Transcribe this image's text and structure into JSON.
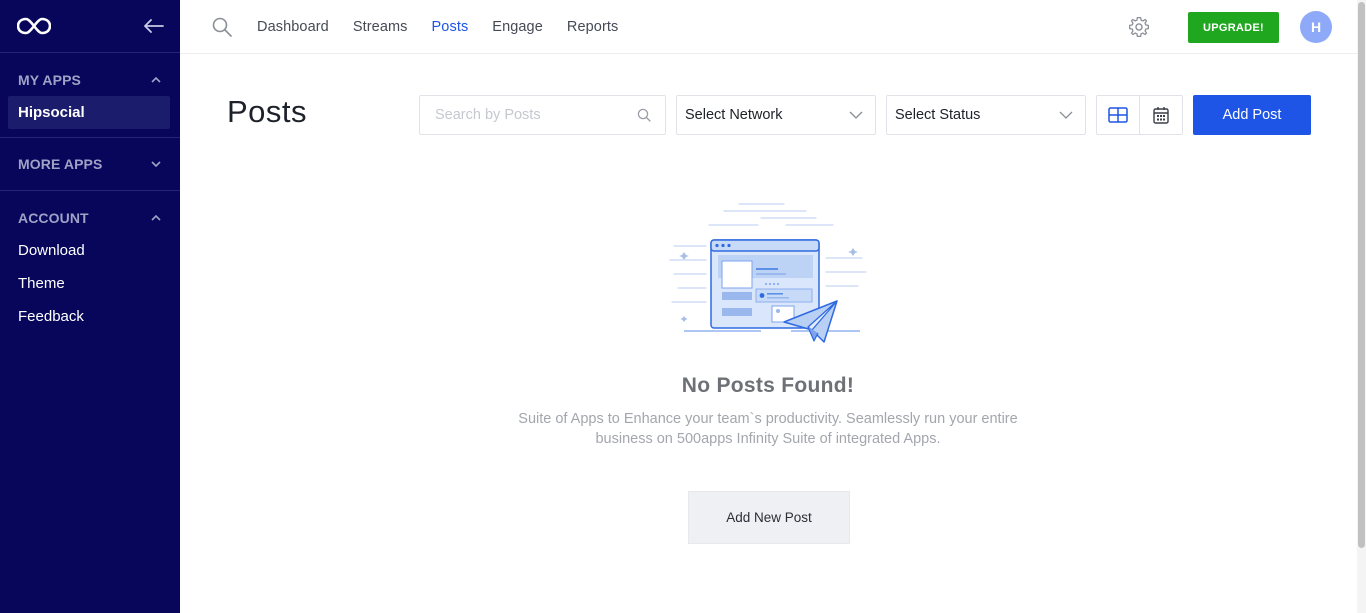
{
  "sidebar": {
    "my_apps_label": "MY APPS",
    "my_apps_items": [
      {
        "label": "Hipsocial"
      }
    ],
    "more_apps_label": "MORE APPS",
    "account_label": "ACCOUNT",
    "account_items": [
      {
        "label": "Download"
      },
      {
        "label": "Theme"
      },
      {
        "label": "Feedback"
      }
    ]
  },
  "topbar": {
    "nav": [
      {
        "label": "Dashboard"
      },
      {
        "label": "Streams"
      },
      {
        "label": "Posts"
      },
      {
        "label": "Engage"
      },
      {
        "label": "Reports"
      }
    ],
    "active_nav": "Posts",
    "upgrade_label": "UPGRADE!",
    "avatar_initial": "H"
  },
  "main": {
    "title": "Posts",
    "search": {
      "placeholder": "Search by Posts",
      "value": ""
    },
    "network_select": {
      "selected": "Select Network"
    },
    "status_select": {
      "selected": "Select Status"
    },
    "add_post_label": "Add Post",
    "empty_state": {
      "title": "No Posts Found!",
      "description_line1": "Suite of Apps to Enhance your team`s productivity. Seamlessly run your entire",
      "description_line2": "business on 500apps Infinity Suite of integrated Apps.",
      "button_label": "Add New Post"
    }
  },
  "colors": {
    "sidebar_bg": "#07065a",
    "accent": "#1e55e6",
    "upgrade": "#1fa81f",
    "avatar": "#8ea9f7"
  }
}
